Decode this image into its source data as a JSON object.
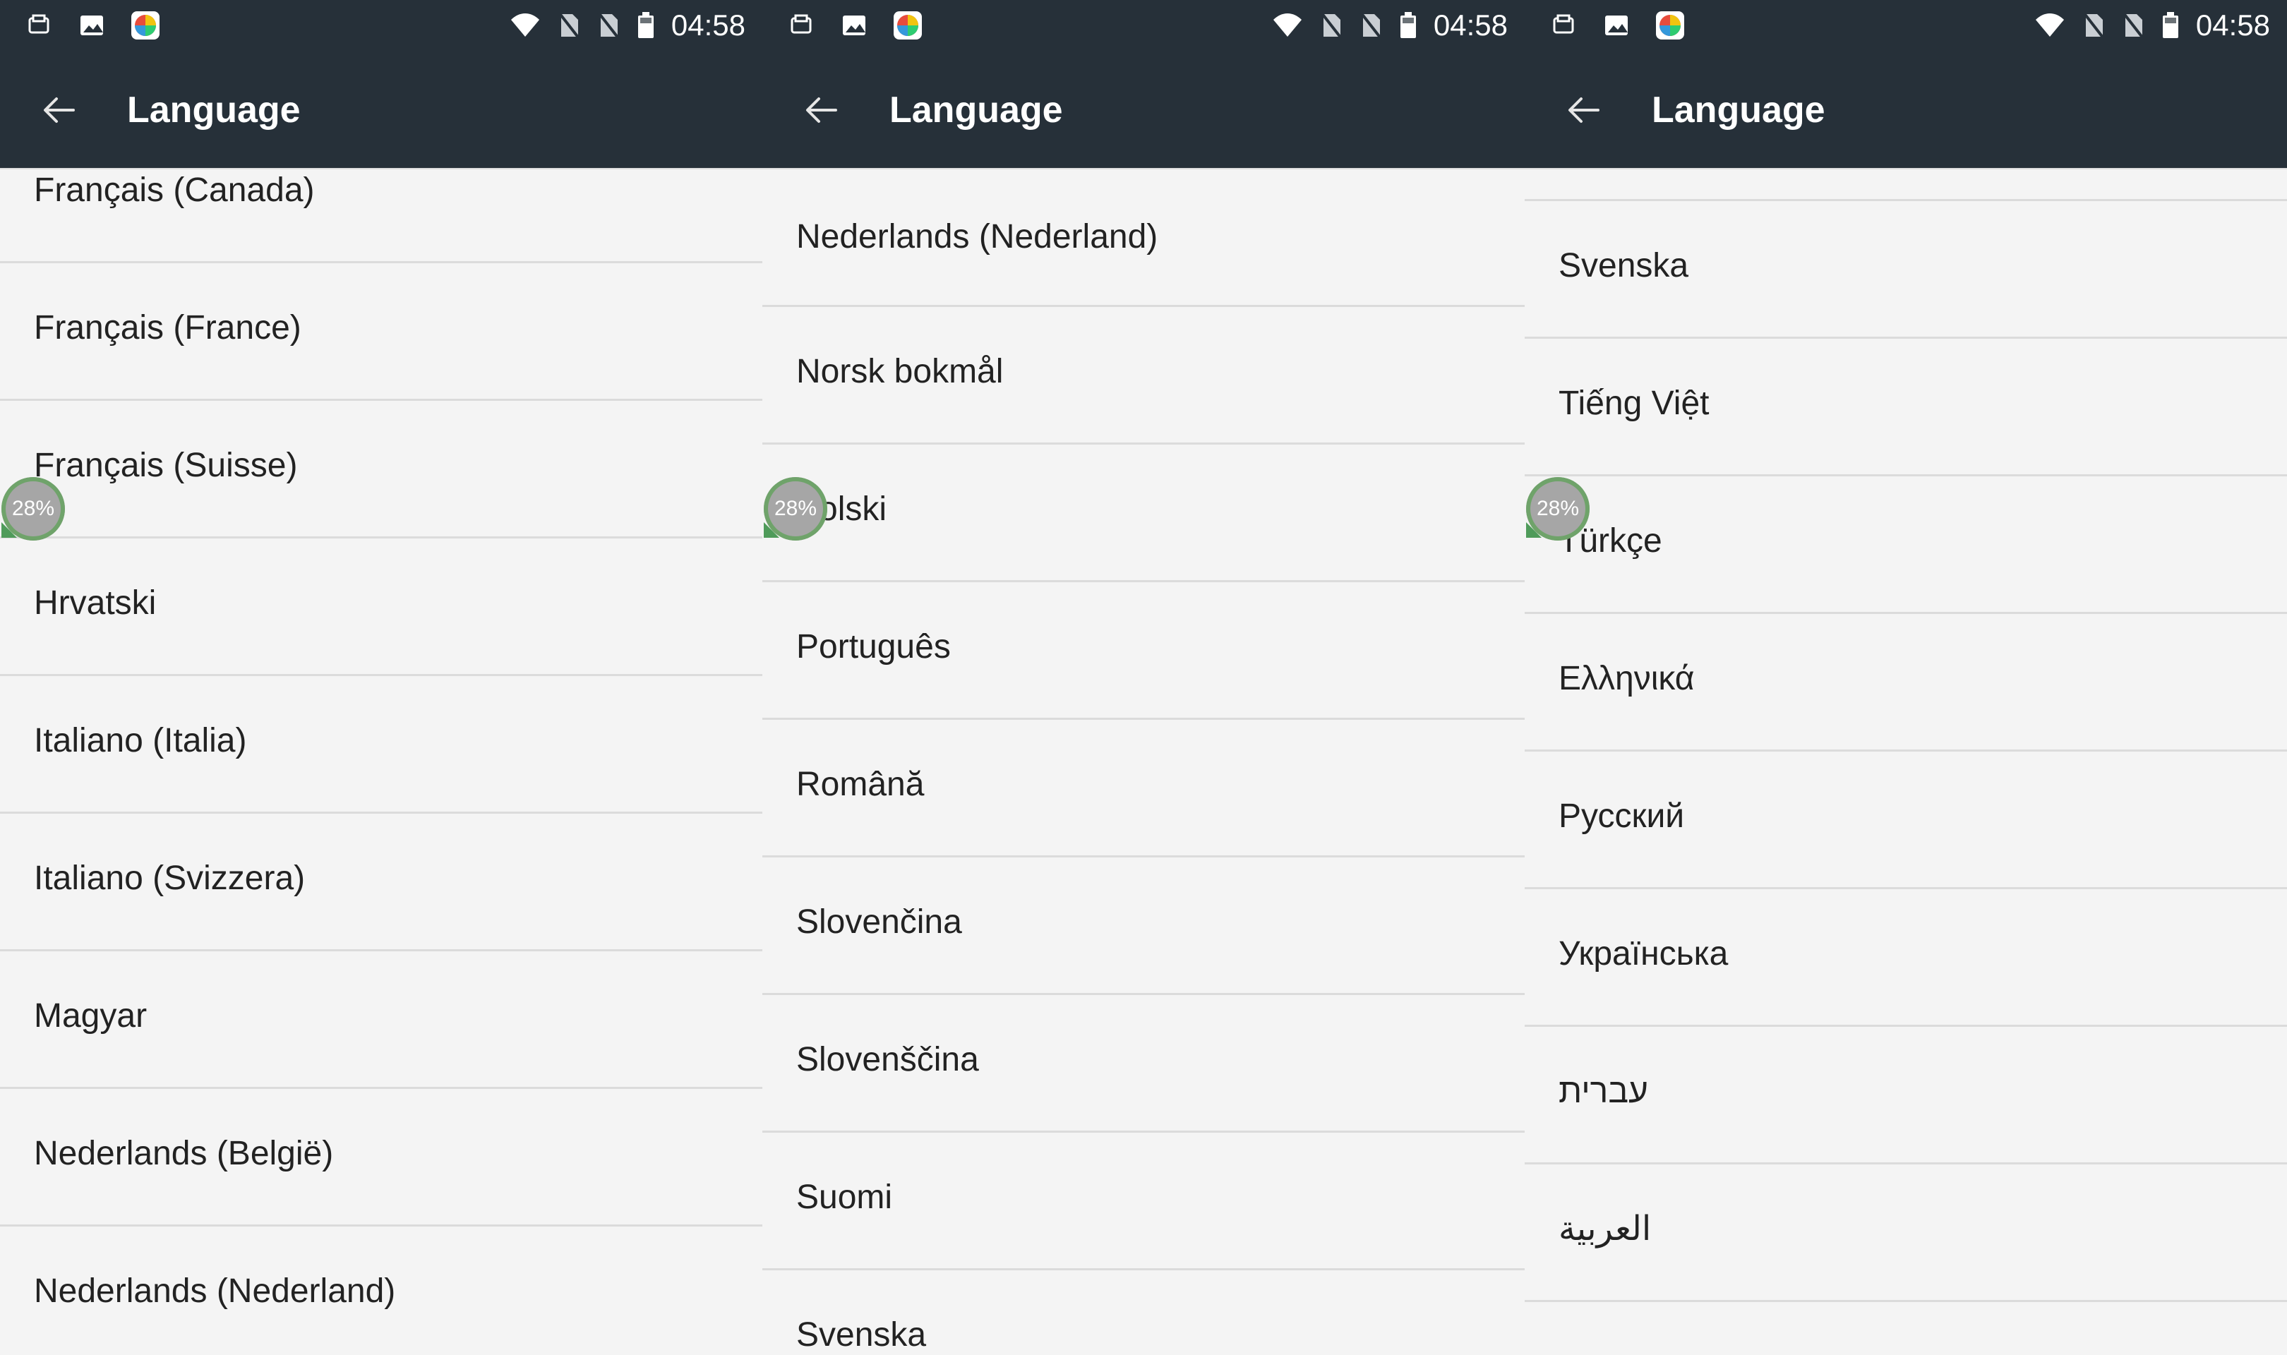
{
  "screens": [
    {
      "status": {
        "time": "04:58"
      },
      "header": {
        "title": "Language"
      },
      "items": [
        "Français (Canada)",
        "Français (France)",
        "Français (Suisse)",
        "Hrvatski",
        "Italiano (Italia)",
        "Italiano (Svizzera)",
        "Magyar",
        "Nederlands (België)",
        "Nederlands (Nederland)"
      ],
      "progress_badge": "28%"
    },
    {
      "status": {
        "time": "04:58"
      },
      "header": {
        "title": "Language"
      },
      "items": [
        "Nederlands (Nederland)",
        "Norsk bokmål",
        "Polski",
        "Português",
        "Română",
        "Slovenčina",
        "Slovenščina",
        "Suomi",
        "Svenska"
      ],
      "progress_badge": "28%"
    },
    {
      "status": {
        "time": "04:58"
      },
      "header": {
        "title": "Language"
      },
      "items": [
        "",
        "Svenska",
        "Tiếng Việt",
        "Türkçe",
        "Ελληνικά",
        "Русский",
        "Українська",
        "עברית",
        "العربية"
      ],
      "progress_badge": "28%"
    }
  ],
  "colors": {
    "status_bar_bg": "#263039",
    "app_bar_bg": "#263039",
    "list_bg": "#f4f4f4",
    "divider": "#dbdbdb",
    "text_primary": "#222222",
    "badge_ring": "#6fa36a",
    "badge_fill": "#a6a6a6"
  },
  "icons": {
    "back": "back-arrow-icon",
    "notification_app": "notification-icon",
    "gallery": "gallery-icon",
    "browser": "browser-icon",
    "wifi": "wifi-icon",
    "sim1": "sim-off-icon",
    "sim2": "sim-off-icon",
    "battery": "battery-icon"
  }
}
